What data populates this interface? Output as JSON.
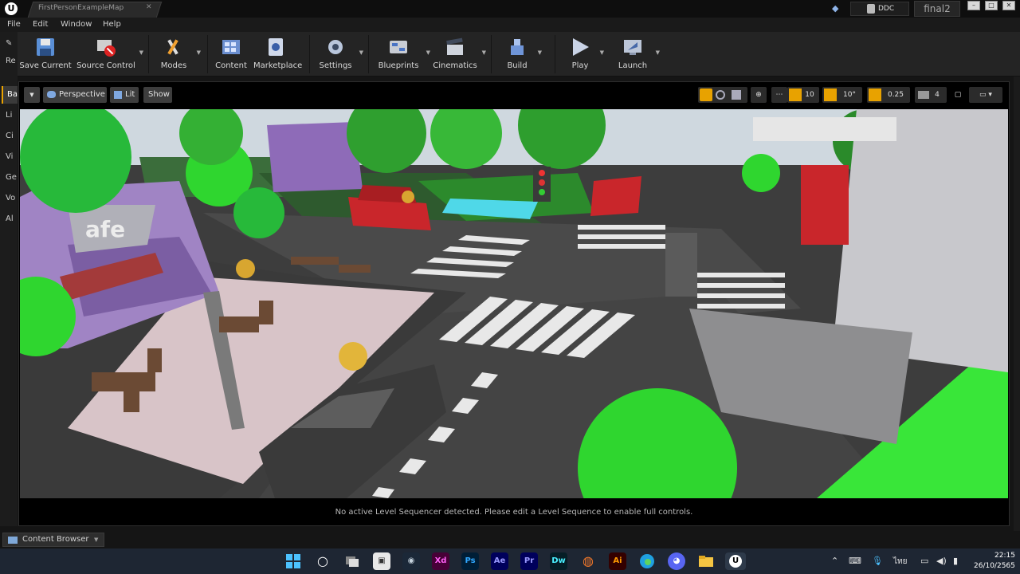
{
  "window": {
    "tab_title": "FirstPersonExampleMap",
    "ddc_label": "DDC",
    "project_name": "final2"
  },
  "menu": [
    "File",
    "Edit",
    "Window",
    "Help"
  ],
  "left_tabs": [
    "Re",
    "Ba",
    "Li",
    "Ci",
    "Vi",
    "Ge",
    "Vo",
    "Al"
  ],
  "toolbar": {
    "save_current": "Save Current",
    "source_control": "Source Control",
    "modes": "Modes",
    "content": "Content",
    "marketplace": "Marketplace",
    "settings": "Settings",
    "blueprints": "Blueprints",
    "cinematics": "Cinematics",
    "build": "Build",
    "play": "Play",
    "launch": "Launch"
  },
  "viewport": {
    "perspective": "Perspective",
    "lit": "Lit",
    "show": "Show",
    "grid_snap": "10",
    "rotation_snap": "10°",
    "scale_snap": "0.25",
    "camera_speed": "4",
    "status": "No active Level Sequencer detected. Please edit a Level Sequence to enable full controls.",
    "sign_text": "afe"
  },
  "content_browser": {
    "label": "Content Browser"
  },
  "taskbar": {
    "apps": [
      "Xd",
      "Ps",
      "Ae",
      "Pr",
      "Dw",
      "Ai"
    ],
    "lang": "ไทย",
    "time": "22:15",
    "date": "26/10/2565"
  },
  "colors": {
    "accent": "#e8a200",
    "grass": "#2fd62f",
    "building_purple": "#8e6bb8",
    "road": "#4a4a4a",
    "car_red": "#c9262b"
  }
}
